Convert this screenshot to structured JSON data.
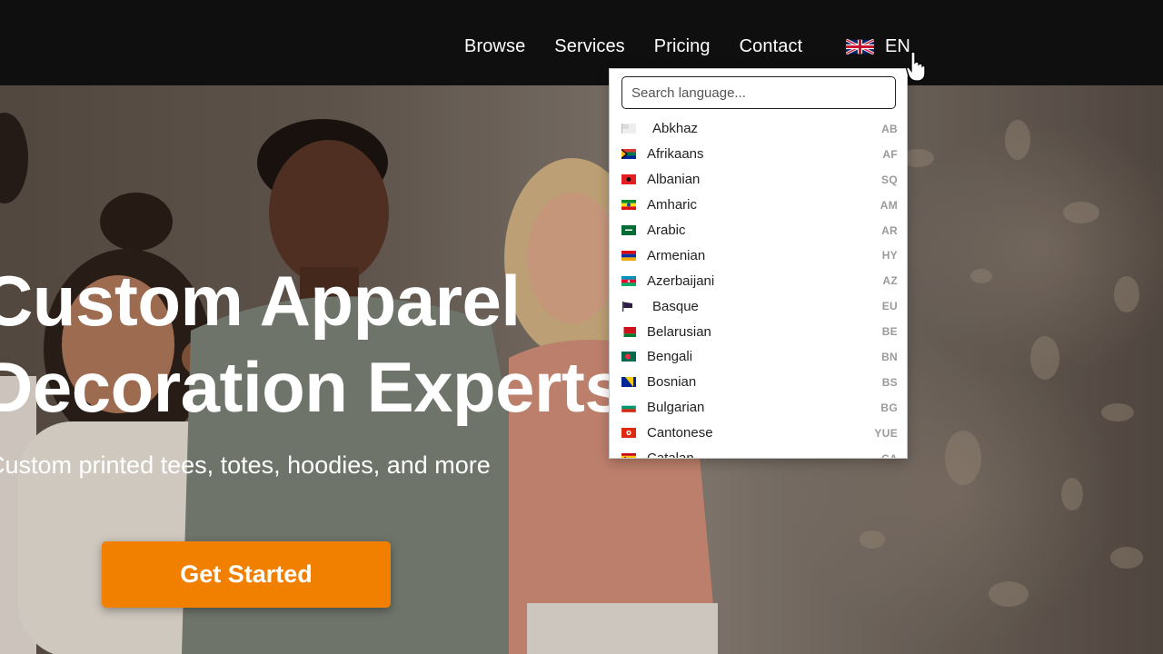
{
  "nav": {
    "items": [
      {
        "label": "Browse"
      },
      {
        "label": "Services"
      },
      {
        "label": "Pricing"
      },
      {
        "label": "Contact"
      }
    ]
  },
  "language_toggle": {
    "code": "EN",
    "flag_icon": "uk-flag-icon"
  },
  "hero": {
    "title_line1": "Custom Apparel",
    "title_line2": "Decoration Experts",
    "subtitle": "Custom printed tees, totes, hoodies, and more",
    "cta_label": "Get Started",
    "cta_color": "#f28000"
  },
  "language_dropdown": {
    "search_placeholder": "Search language...",
    "languages": [
      {
        "name": "Abkhaz",
        "code": "AB"
      },
      {
        "name": "Afrikaans",
        "code": "AF"
      },
      {
        "name": "Albanian",
        "code": "SQ"
      },
      {
        "name": "Amharic",
        "code": "AM"
      },
      {
        "name": "Arabic",
        "code": "AR"
      },
      {
        "name": "Armenian",
        "code": "HY"
      },
      {
        "name": "Azerbaijani",
        "code": "AZ"
      },
      {
        "name": "Basque",
        "code": "EU"
      },
      {
        "name": "Belarusian",
        "code": "BE"
      },
      {
        "name": "Bengali",
        "code": "BN"
      },
      {
        "name": "Bosnian",
        "code": "BS"
      },
      {
        "name": "Bulgarian",
        "code": "BG"
      },
      {
        "name": "Cantonese",
        "code": "YUE"
      },
      {
        "name": "Catalan",
        "code": "CA"
      }
    ]
  }
}
